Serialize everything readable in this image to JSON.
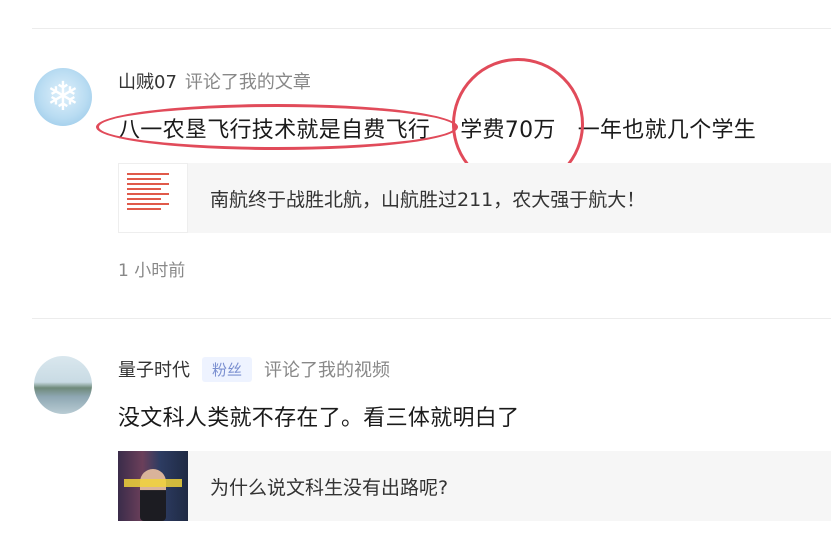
{
  "comments": [
    {
      "avatar_icon": "snowflake-icon",
      "username": "山贼07",
      "badge": "",
      "action": "评论了我的文章",
      "text_part1": "八一农垦飞行技术就是自费飞行",
      "text_part2": "学费70万",
      "text_part3": "一年也就几个学生",
      "ref_title": "南航终于战胜北航，山航胜过211，农大强于航大！",
      "time": "1 小时前"
    },
    {
      "avatar_icon": "lake-landscape-icon",
      "username": "量子时代",
      "badge": "粉丝",
      "action": "评论了我的视频",
      "text": "没文科人类就不存在了。看三体就明白了",
      "ref_title": "为什么说文科生没有出路呢?"
    }
  ],
  "annotation_color": "#e14b5a"
}
